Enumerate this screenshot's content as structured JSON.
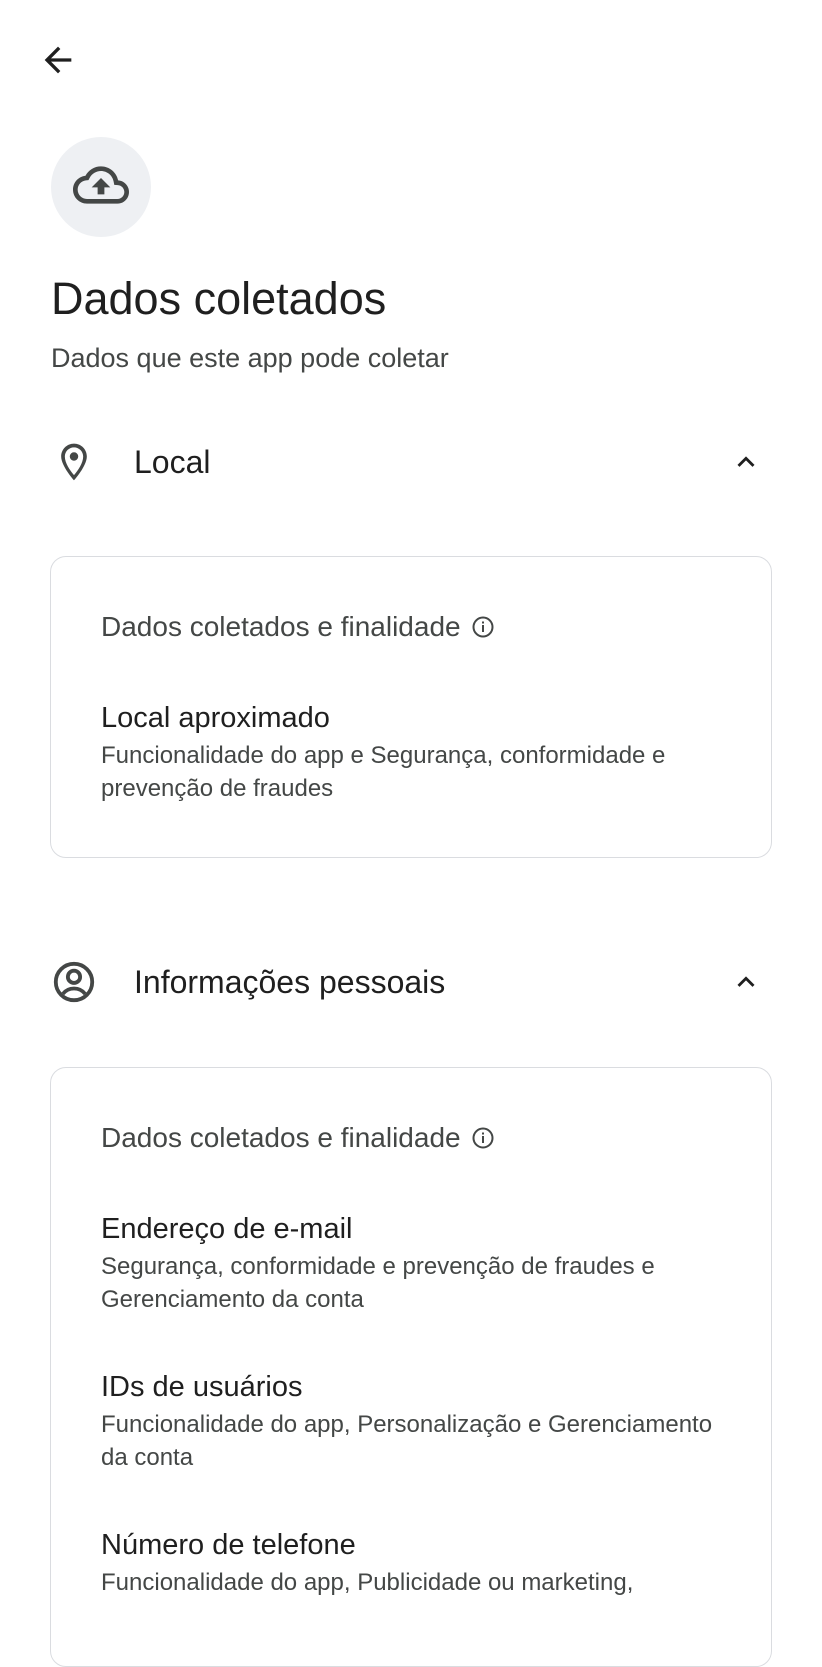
{
  "header": {
    "back_icon": "arrow-back-icon",
    "hero_icon": "cloud-upload-icon",
    "title": "Dados coletados",
    "subtitle": "Dados que este app pode coletar"
  },
  "sections": [
    {
      "label": "Local",
      "icon": "location-pin-icon",
      "expanded": true,
      "card": {
        "heading": "Dados coletados e finalidade",
        "items": [
          {
            "title": "Local aproximado",
            "desc": "Funcionalidade do app e Segurança, conformidade e prevenção de fraudes"
          }
        ]
      }
    },
    {
      "label": "Informações pessoais",
      "icon": "account-circle-icon",
      "expanded": true,
      "card": {
        "heading": "Dados coletados e finalidade",
        "items": [
          {
            "title": "Endereço de e-mail",
            "desc": "Segurança, conformidade e prevenção de fraudes e Gerenciamento da conta"
          },
          {
            "title": "IDs de usuários",
            "desc": "Funcionalidade do app, Personalização e Gerenciamento da conta"
          },
          {
            "title": "Número de telefone",
            "desc": "Funcionalidade do app, Publicidade ou marketing,"
          }
        ]
      }
    }
  ],
  "colors": {
    "text_primary": "#1f1f1f",
    "text_secondary": "#444746",
    "card_border": "#dadce0",
    "icon_bg": "#eef0f3"
  }
}
